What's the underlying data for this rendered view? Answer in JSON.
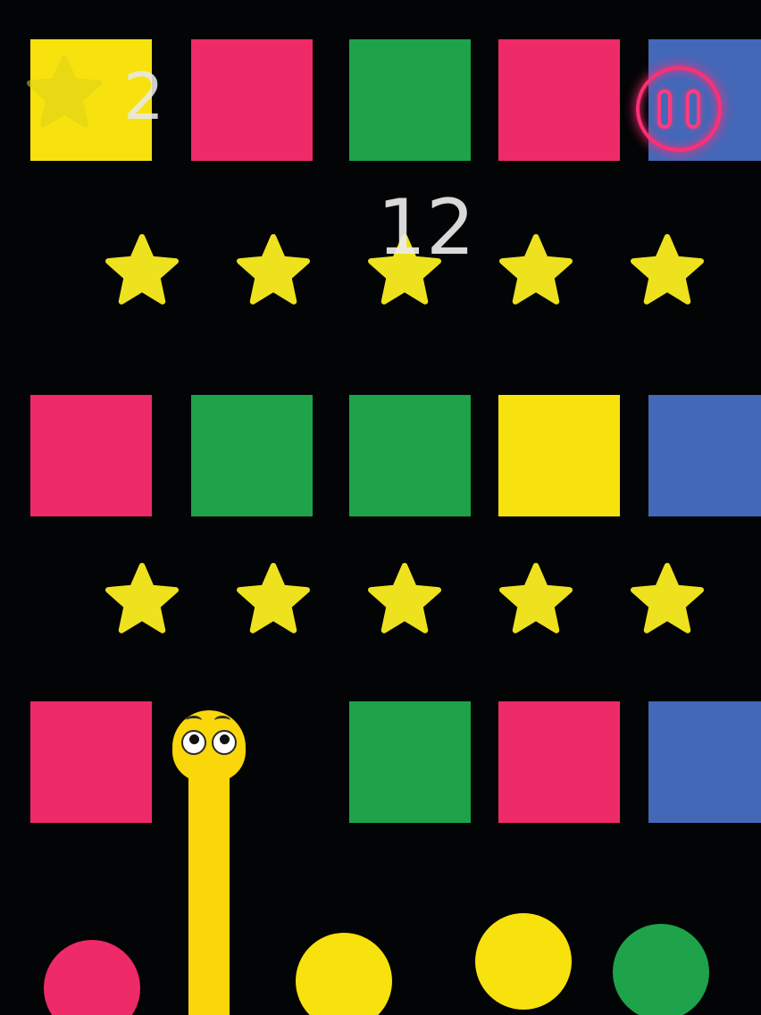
{
  "hud": {
    "stars_collected": "2",
    "score": "12",
    "star_icon": "star-icon",
    "pause_icon": "pause-icon"
  },
  "colors": {
    "yellow": "#f8e20e",
    "pink": "#ee2a68",
    "green": "#1ea24a",
    "blue": "#4468b8",
    "star": "#eee21e",
    "snake": "#fad70a",
    "pause_glow": "#ff2f76",
    "background": "#030405"
  },
  "block_rows": [
    [
      "yellow",
      "pink",
      "green",
      "pink",
      "blue"
    ],
    [
      "pink",
      "green",
      "green",
      "yellow",
      "blue"
    ],
    [
      "pink",
      "",
      "green",
      "pink",
      "blue"
    ]
  ],
  "star_rows": [
    5,
    5
  ],
  "orbs": [
    "pink",
    "yellow",
    "yellow",
    "green"
  ],
  "snake": {
    "color": "yellow"
  }
}
